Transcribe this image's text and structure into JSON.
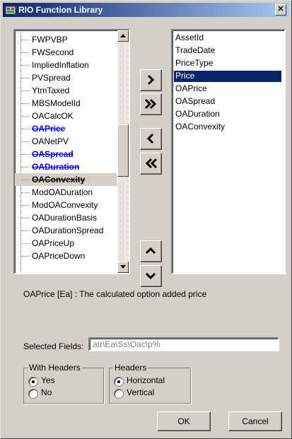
{
  "window": {
    "title": "RIO Function Library",
    "close_glyph": "✕",
    "icon": "app-icon"
  },
  "left_list": {
    "items": [
      {
        "label": "FWPVBP",
        "state": "normal"
      },
      {
        "label": "FWSecond",
        "state": "normal"
      },
      {
        "label": "ImpliedInflation",
        "state": "normal"
      },
      {
        "label": "PVSpread",
        "state": "normal"
      },
      {
        "label": "YtmTaxed",
        "state": "normal"
      },
      {
        "label": "MBSModelId",
        "state": "normal"
      },
      {
        "label": "OACalcOK",
        "state": "normal"
      },
      {
        "label": "OAPrice",
        "state": "selected-blue"
      },
      {
        "label": "OANetPV",
        "state": "normal"
      },
      {
        "label": "OASpread",
        "state": "selected-blue"
      },
      {
        "label": "OADuration",
        "state": "selected-blue"
      },
      {
        "label": "OAConvexity",
        "state": "selected-gray"
      },
      {
        "label": "ModOADuration",
        "state": "normal"
      },
      {
        "label": "ModOAConvexity",
        "state": "normal"
      },
      {
        "label": "OADurationBasis",
        "state": "normal"
      },
      {
        "label": "OADurationSpread",
        "state": "normal"
      },
      {
        "label": "OAPriceUp",
        "state": "normal"
      },
      {
        "label": "OAPriceDown",
        "state": "normal"
      }
    ]
  },
  "right_list": {
    "items": [
      "AssetId",
      "TradeDate",
      "PriceType",
      "Price",
      "OAPrice",
      "OASpread",
      "OADuration",
      "OAConvexity"
    ],
    "selected": "Price"
  },
  "move_buttons": {
    "add": "add-icon",
    "add_all": "add-all-icon",
    "remove": "remove-icon",
    "remove_all": "remove-all-icon",
    "up": "move-up-icon",
    "down": "move-down-icon"
  },
  "description": "OAPrice [Ea] : The calculated option added price",
  "selected_fields": {
    "label": "Selected Fields:",
    "value": "atr\\Ea\\Ss\\Oac\\p%"
  },
  "with_headers": {
    "legend": "With Headers",
    "options": [
      "Yes",
      "No"
    ],
    "selected": "Yes"
  },
  "headers": {
    "legend": "Headers",
    "options": [
      "Horizontal",
      "Vertical"
    ],
    "selected": "Horizontal"
  },
  "buttons": {
    "ok": "OK",
    "cancel": "Cancel"
  }
}
